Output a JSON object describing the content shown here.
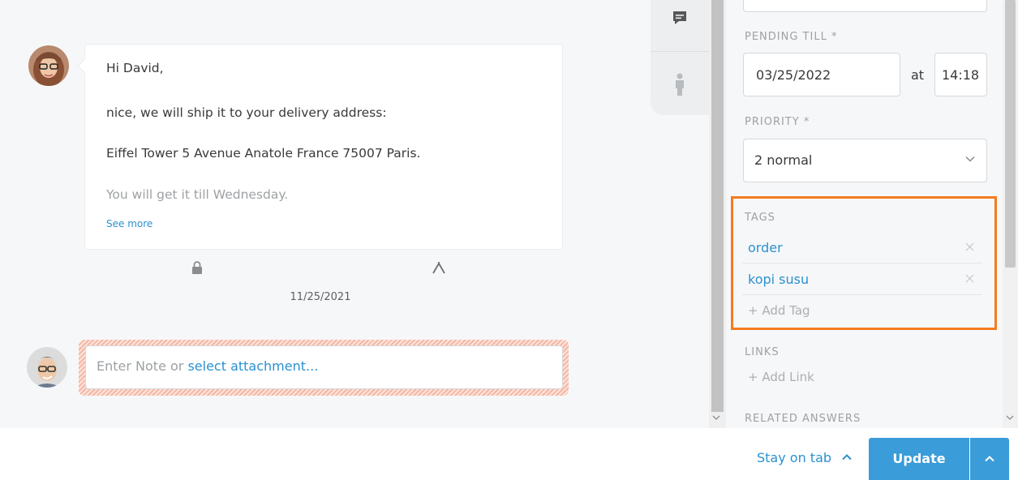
{
  "article": {
    "greeting": "Hi David,",
    "line1": "nice, we will ship it to your delivery address:",
    "line2": "Eiffel Tower 5 Avenue Anatole France 75007 Paris.",
    "line3": "You will get it till Wednesday.",
    "see_more": "See more",
    "date": "11/25/2021"
  },
  "note": {
    "placeholder_prefix": "Enter Note or ",
    "attachment_link": "select attachment..."
  },
  "sidebar": {
    "pending_label": "PENDING TILL *",
    "pending_date": "03/25/2022",
    "at_label": "at",
    "pending_time": "14:18",
    "priority_label": "PRIORITY *",
    "priority_value": "2 normal",
    "tags_label": "TAGS",
    "tags": [
      "order",
      "kopi susu"
    ],
    "add_tag": "+ Add Tag",
    "links_label": "LINKS",
    "add_link": "+ Add Link",
    "related_label": "RELATED ANSWERS"
  },
  "footer": {
    "stay_on_tab": "Stay on tab",
    "update": "Update"
  },
  "colors": {
    "accent": "#2b91d0",
    "primary_button": "#3a9cd9",
    "highlight_frame": "#f57b20"
  },
  "icons": [
    "chat-icon",
    "customer-icon",
    "lock-icon",
    "split-icon",
    "chevron-down-icon",
    "close-icon",
    "chevron-up-icon"
  ]
}
